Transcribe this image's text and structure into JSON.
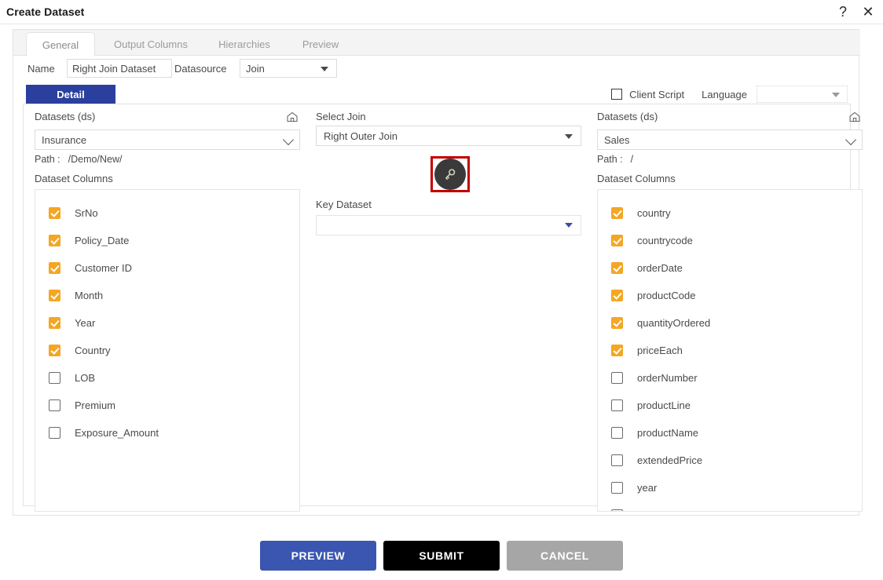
{
  "titlebar": {
    "title": "Create Dataset",
    "help_icon": "question-mark-icon",
    "close_icon": "close-icon"
  },
  "tabs": [
    {
      "label": "General",
      "active": true
    },
    {
      "label": "Output Columns",
      "active": false
    },
    {
      "label": "Hierarchies",
      "active": false
    },
    {
      "label": "Preview",
      "active": false
    }
  ],
  "form": {
    "name_label": "Name",
    "name_value": "Right Join Dataset",
    "datasource_label": "Datasource",
    "datasource_value": "Join"
  },
  "detail_tab": {
    "label": "Detail"
  },
  "client_script": {
    "label": "Client Script",
    "checked": false,
    "language_label": "Language",
    "language_value": ""
  },
  "left_panel": {
    "datasets_label": "Datasets (ds)",
    "home_icon": "home-icon",
    "dataset_value": "Insurance",
    "path_label": "Path :",
    "path_value": "/Demo/New/",
    "columns_label": "Dataset Columns",
    "columns": [
      {
        "label": "SrNo",
        "checked": true
      },
      {
        "label": "Policy_Date",
        "checked": true
      },
      {
        "label": "Customer ID",
        "checked": true
      },
      {
        "label": "Month",
        "checked": true
      },
      {
        "label": "Year",
        "checked": true
      },
      {
        "label": "Country",
        "checked": true
      },
      {
        "label": "LOB",
        "checked": false
      },
      {
        "label": "Premium",
        "checked": false
      },
      {
        "label": "Exposure_Amount",
        "checked": false
      }
    ]
  },
  "center_panel": {
    "select_join_label": "Select Join",
    "join_value": "Right Outer Join",
    "key_button_icon": "key-icon",
    "key_dataset_label": "Key Dataset",
    "key_dataset_value": ""
  },
  "right_panel": {
    "datasets_label": "Datasets (ds)",
    "home_icon": "home-icon",
    "dataset_value": "Sales",
    "path_label": "Path :",
    "path_value": "/",
    "columns_label": "Dataset Columns",
    "columns": [
      {
        "label": "country",
        "checked": true
      },
      {
        "label": "countrycode",
        "checked": true
      },
      {
        "label": "orderDate",
        "checked": true
      },
      {
        "label": "productCode",
        "checked": true
      },
      {
        "label": "quantityOrdered",
        "checked": true
      },
      {
        "label": "priceEach",
        "checked": true
      },
      {
        "label": "orderNumber",
        "checked": false
      },
      {
        "label": "productLine",
        "checked": false
      },
      {
        "label": "productName",
        "checked": false
      },
      {
        "label": "extendedPrice",
        "checked": false
      },
      {
        "label": "year",
        "checked": false
      },
      {
        "label": "",
        "checked": false
      }
    ]
  },
  "footer": {
    "preview_label": "PREVIEW",
    "submit_label": "SUBMIT",
    "cancel_label": "CANCEL"
  },
  "colors": {
    "checkbox_checked": "#f5a623",
    "detail_tab": "#2b3f9e",
    "preview_button": "#3a56b0",
    "submit_button": "#000000",
    "cancel_button": "#a6a6a6",
    "highlight_box": "#c00000"
  }
}
